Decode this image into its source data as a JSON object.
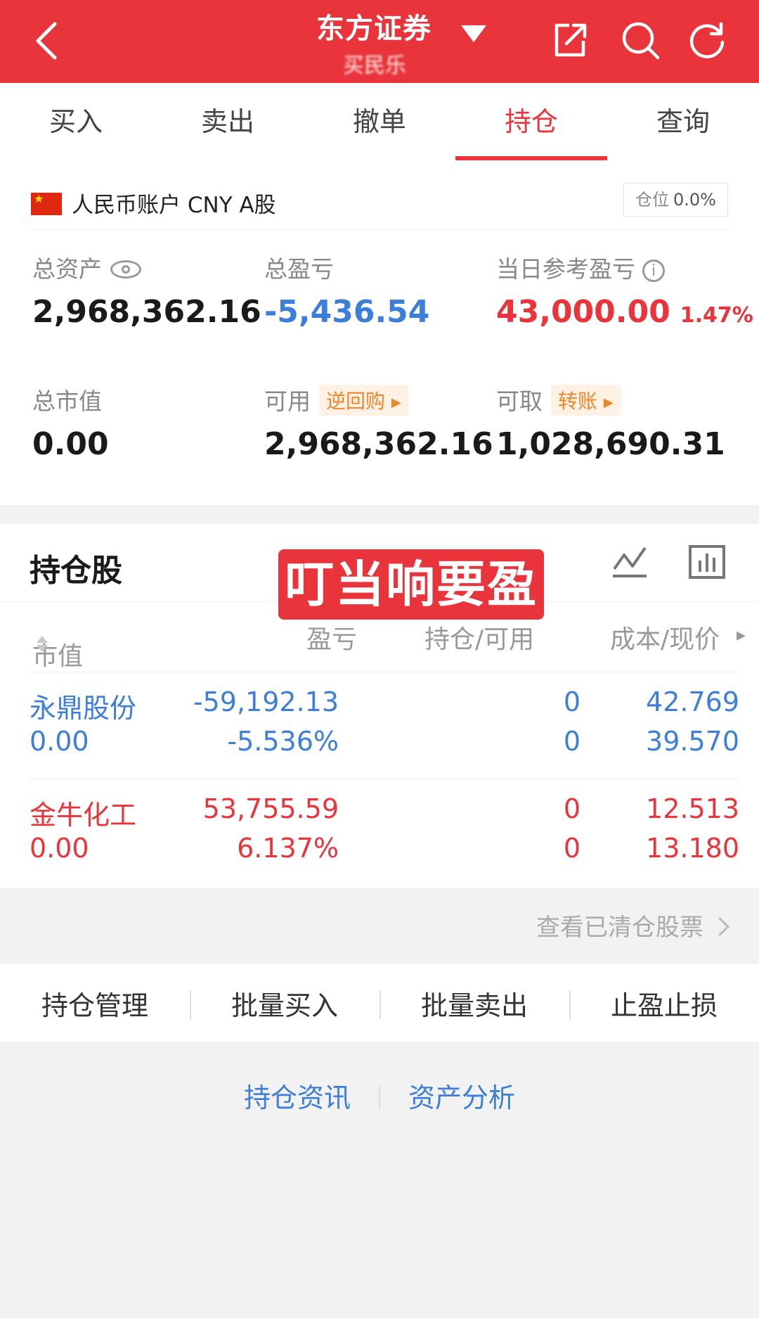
{
  "header": {
    "title": "东方证券",
    "subtitle": "买民乐",
    "bg_color": "#e8343a",
    "icons": [
      "back-icon",
      "dropdown-caret-icon",
      "share-icon",
      "search-icon",
      "refresh-icon"
    ]
  },
  "tabs": [
    {
      "label": "买入",
      "active": false
    },
    {
      "label": "卖出",
      "active": false
    },
    {
      "label": "撤单",
      "active": false
    },
    {
      "label": "持仓",
      "active": true
    },
    {
      "label": "查询",
      "active": false
    }
  ],
  "account": {
    "name": "人民币账户 CNY A股",
    "position_label": "仓位",
    "position_value": "0.0%",
    "total_assets": {
      "label": "总资产",
      "value": "2,968,362.16"
    },
    "total_pnl": {
      "label": "总盈亏",
      "value": "-5,436.54"
    },
    "daily_pnl": {
      "label": "当日参考盈亏",
      "value": "43,000.00",
      "pct": "1.47%"
    },
    "market_value": {
      "label": "总市值",
      "value": "0.00"
    },
    "available": {
      "label": "可用",
      "value": "2,968,362.16",
      "chip": "逆回购"
    },
    "withdrawable": {
      "label": "可取",
      "value": "1,028,690.31",
      "chip": "转账"
    }
  },
  "holdings": {
    "title": "持仓股",
    "watermark": "叮当响要盈",
    "columns": {
      "market_value": "市值",
      "pnl": "盈亏",
      "qty": "持仓/可用",
      "cost": "成本/现价"
    },
    "rows": [
      {
        "name": "永鼎股份",
        "value": "0.00",
        "pnl": "-59,192.13",
        "pnl_pct": "-5.536%",
        "qty": "0",
        "avail": "0",
        "cost": "42.769",
        "price": "39.570",
        "color": "#3d7ed9"
      },
      {
        "name": "金牛化工",
        "value": "0.00",
        "pnl": "53,755.59",
        "pnl_pct": "6.137%",
        "qty": "0",
        "avail": "0",
        "cost": "12.513",
        "price": "13.180",
        "color": "#e8343a"
      }
    ],
    "cleared_link": "查看已清仓股票"
  },
  "actions": [
    "持仓管理",
    "批量买入",
    "批量卖出",
    "止盈止损"
  ],
  "footer_links": [
    "持仓资讯",
    "资产分析"
  ]
}
